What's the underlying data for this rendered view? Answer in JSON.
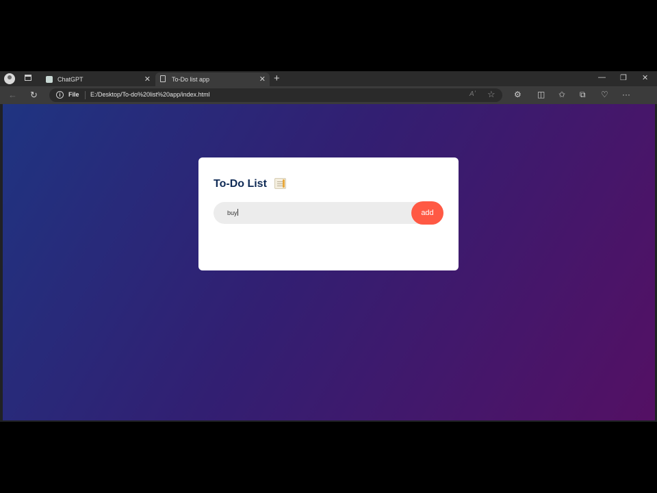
{
  "browser": {
    "tabs": [
      {
        "label": "ChatGPT",
        "active": false
      },
      {
        "label": "To-Do list app",
        "active": true
      }
    ],
    "address_scheme": "File",
    "address_url": "E:/Desktop/To-do%20list%20app/index.html",
    "read_aloud_label": "Aʼ"
  },
  "app": {
    "title": "To-Do List",
    "input_value": "buy",
    "add_label": "add",
    "colors": {
      "gradient_start": "#1f3481",
      "gradient_end": "#541064",
      "add_button": "#ff5944",
      "title": "#0f2a55"
    }
  },
  "icons": [
    "profile-icon",
    "workspaces-icon",
    "chatgpt-favicon",
    "document-favicon",
    "close-icon",
    "new-tab-icon",
    "minimize-icon",
    "restore-icon",
    "window-close-icon",
    "back-icon",
    "reload-icon",
    "info-icon",
    "favorite-star-icon",
    "extensions-icon",
    "split-screen-icon",
    "favorites-icon",
    "collections-icon",
    "browser-essentials-icon",
    "more-icon",
    "copilot-icon",
    "notepad-icon"
  ]
}
